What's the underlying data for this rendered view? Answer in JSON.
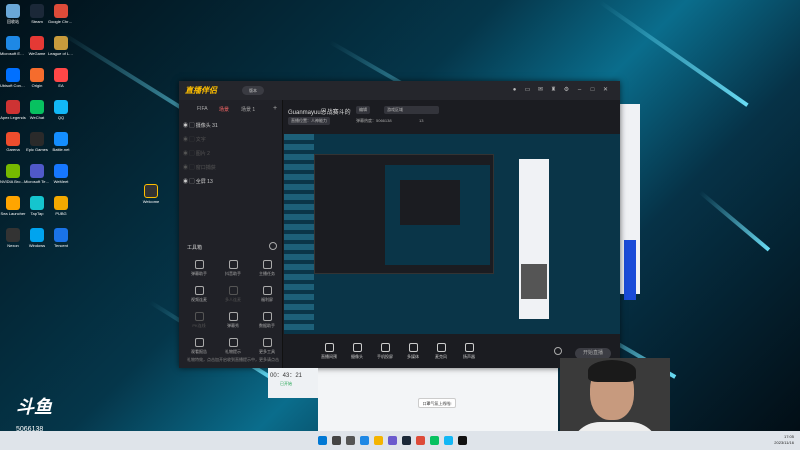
{
  "colors": {
    "accent": "#ff6a6a",
    "brand": "#ffbf00",
    "live_button": "#3c3d44"
  },
  "desktop_icons": [
    {
      "label": "回收站",
      "color": "#6aa8d8"
    },
    {
      "label": "Steam",
      "color": "#1b2838"
    },
    {
      "label": "Google Chrome",
      "color": "#dd4b39"
    },
    {
      "label": "Microsoft Edge",
      "color": "#1e88e5"
    },
    {
      "label": "WeGame",
      "color": "#e53935"
    },
    {
      "label": "League of Legends",
      "color": "#c89b3c"
    },
    {
      "label": "Ubisoft Connect",
      "color": "#0070ff"
    },
    {
      "label": "Origin",
      "color": "#f56c2d"
    },
    {
      "label": "EA",
      "color": "#ff4747"
    },
    {
      "label": "Apex Legends",
      "color": "#cd3333"
    },
    {
      "label": "WeChat",
      "color": "#07c160"
    },
    {
      "label": "QQ",
      "color": "#12b7f5"
    },
    {
      "label": "Garena",
      "color": "#ee4d2d"
    },
    {
      "label": "Epic Games",
      "color": "#2a2a2a"
    },
    {
      "label": "Battle.net",
      "color": "#148eff"
    },
    {
      "label": "NVIDIA Broadcast",
      "color": "#76b900"
    },
    {
      "label": "Microsoft Teams",
      "color": "#5059c9"
    },
    {
      "label": "WeMeet",
      "color": "#1677ff"
    },
    {
      "label": "Sea Launcher",
      "color": "#ffa500"
    },
    {
      "label": "TapTap",
      "color": "#15c5ce"
    },
    {
      "label": "PUBG",
      "color": "#f2a900"
    },
    {
      "label": "Nexon",
      "color": "#333333"
    },
    {
      "label": "Windows",
      "color": "#00a4ef"
    },
    {
      "label": "Tencent",
      "color": "#1a73e8"
    }
  ],
  "desktop_icon_right": {
    "label": "Welcome"
  },
  "app": {
    "logo_text": "直播伴侣",
    "version": "版本",
    "title_icons": [
      "avatar-icon",
      "message-icon",
      "mail-icon",
      "shirt-icon",
      "gear-icon",
      "minimize-icon",
      "maximize-icon",
      "close-icon"
    ],
    "left_tabs": [
      "FIFA",
      "场景",
      "场景 1"
    ],
    "sources": [
      {
        "label": "摄像头 31",
        "dim": false
      },
      {
        "label": "文字",
        "dim": true
      },
      {
        "label": "图片 2",
        "dim": true
      },
      {
        "label": "窗口捕获",
        "dim": true
      },
      {
        "label": "全屏 13",
        "dim": false
      }
    ],
    "tools_title": "工具箱",
    "tools": [
      {
        "label": "弹幕助手",
        "dim": false
      },
      {
        "label": "抖音助手",
        "dim": false
      },
      {
        "label": "主播任务",
        "dim": false
      },
      {
        "label": "视频连麦",
        "dim": false
      },
      {
        "label": "多人连麦",
        "dim": true
      },
      {
        "label": "福利屏",
        "dim": false
      },
      {
        "label": "PK连线",
        "dim": true
      },
      {
        "label": "弹幕秀",
        "dim": false
      },
      {
        "label": "数据助手",
        "dim": false
      },
      {
        "label": "观看报告",
        "dim": false
      },
      {
        "label": "礼物提示",
        "dim": false
      },
      {
        "label": "更多工具",
        "dim": false
      }
    ],
    "room": {
      "name": "Guanmayuu恩战赛斗的",
      "edit_label": "编辑",
      "category_label": "游戏区域",
      "stat_label": "直播位置：人神能力",
      "watch_label": "弹幕热度：5066138",
      "fans_label": "13"
    },
    "bottom_tools": [
      {
        "label": "直播间预",
        "icon": "screen-icon"
      },
      {
        "label": "摄像头",
        "icon": "camera-icon"
      },
      {
        "label": "手机投屏",
        "icon": "phone-cast-icon"
      },
      {
        "label": "多媒体",
        "icon": "media-icon"
      },
      {
        "label": "麦克风",
        "icon": "mic-icon"
      },
      {
        "label": "扬声器",
        "icon": "speaker-icon"
      }
    ],
    "start_button": "开始直播",
    "footer_notice": "礼物特效，点击加开启收到直播提示中，更多请点击"
  },
  "watermark": {
    "logo": "斗鱼",
    "room_id": "5066138"
  },
  "timer": "00：43：21",
  "timer_status": "已开始",
  "chat_bubble": "口罩气氛上线啦!",
  "clock": {
    "time": "17:05",
    "date": "2023/11/16"
  },
  "taskbar_apps": [
    "windows-icon",
    "search-icon",
    "taskview-icon",
    "edge-icon",
    "explorer-icon",
    "store-icon",
    "steam-icon",
    "chrome-icon",
    "wechat-icon",
    "qq-icon",
    "live-icon"
  ]
}
